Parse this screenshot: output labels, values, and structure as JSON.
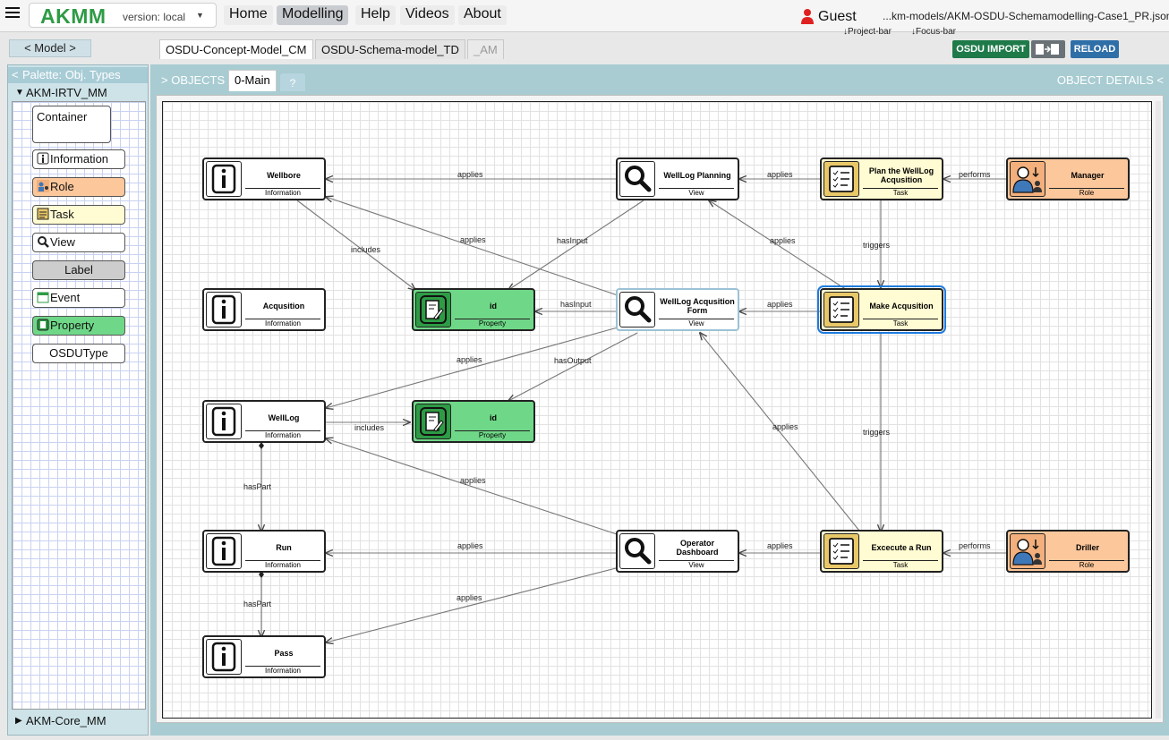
{
  "app": {
    "brand": "AKMM",
    "version": "version: local",
    "user": "Guest",
    "file_path": "...km-models/AKM-OSDU-Schemamodelling-Case1_PR.json",
    "hint_project_bar": "↓Project-bar",
    "hint_focus_bar": "↓Focus-bar"
  },
  "nav": {
    "home": "Home",
    "modelling": "Modelling",
    "help": "Help",
    "videos": "Videos",
    "about": "About"
  },
  "model_bar": {
    "model_button": "< Model >",
    "tabs": [
      "OSDU-Concept-Model_CM",
      "OSDU-Schema-model_TD",
      "_AM"
    ],
    "osdu_import": "OSDU IMPORT",
    "reload": "RELOAD"
  },
  "palette": {
    "title": "Palette: Obj. Types",
    "group_open": "AKM-IRTV_MM",
    "group_closed": "AKM-Core_MM",
    "items": [
      "Container",
      "Information",
      "Role",
      "Task",
      "View",
      "Label",
      "Event",
      "Property",
      "OSDUType"
    ]
  },
  "main": {
    "objects_label": "OBJECTS",
    "active_tab": "0-Main",
    "help_tab": "?",
    "details_label": "OBJECT DETAILS"
  },
  "nodes": {
    "wellbore": {
      "name": "Wellbore",
      "type": "Information"
    },
    "acqusition": {
      "name": "Acqusition",
      "type": "Information"
    },
    "welllog": {
      "name": "WellLog",
      "type": "Information"
    },
    "run": {
      "name": "Run",
      "type": "Information"
    },
    "pass": {
      "name": "Pass",
      "type": "Information"
    },
    "id1": {
      "name": "id",
      "type": "Property"
    },
    "id2": {
      "name": "id",
      "type": "Property"
    },
    "wlplanning": {
      "name": "WellLog Planning",
      "type": "View"
    },
    "wlform": {
      "name": "WellLog Acqusition Form",
      "type": "View"
    },
    "opdash": {
      "name": "Operator Dashboard",
      "type": "View"
    },
    "plan": {
      "name": "Plan the WellLog Acqusition",
      "type": "Task"
    },
    "make": {
      "name": "Make Acqusition",
      "type": "Task"
    },
    "execute": {
      "name": "Excecute a Run",
      "type": "Task"
    },
    "manager": {
      "name": "Manager",
      "type": "Role"
    },
    "driller": {
      "name": "Driller",
      "type": "Role"
    }
  },
  "links": {
    "applies": "applies",
    "includes": "includes",
    "hasInput": "hasInput",
    "hasOutput": "hasOutput",
    "hasPart": "hasPart",
    "performs": "performs",
    "triggers": "triggers"
  },
  "colors": {
    "brand": "#2e9b45",
    "task": "#fffbd2",
    "role": "#fcc79b",
    "property": "#6fd888",
    "osdu_import": "#1f7a4a",
    "reload": "#2f6fa8",
    "selection": "#1e7be0"
  }
}
